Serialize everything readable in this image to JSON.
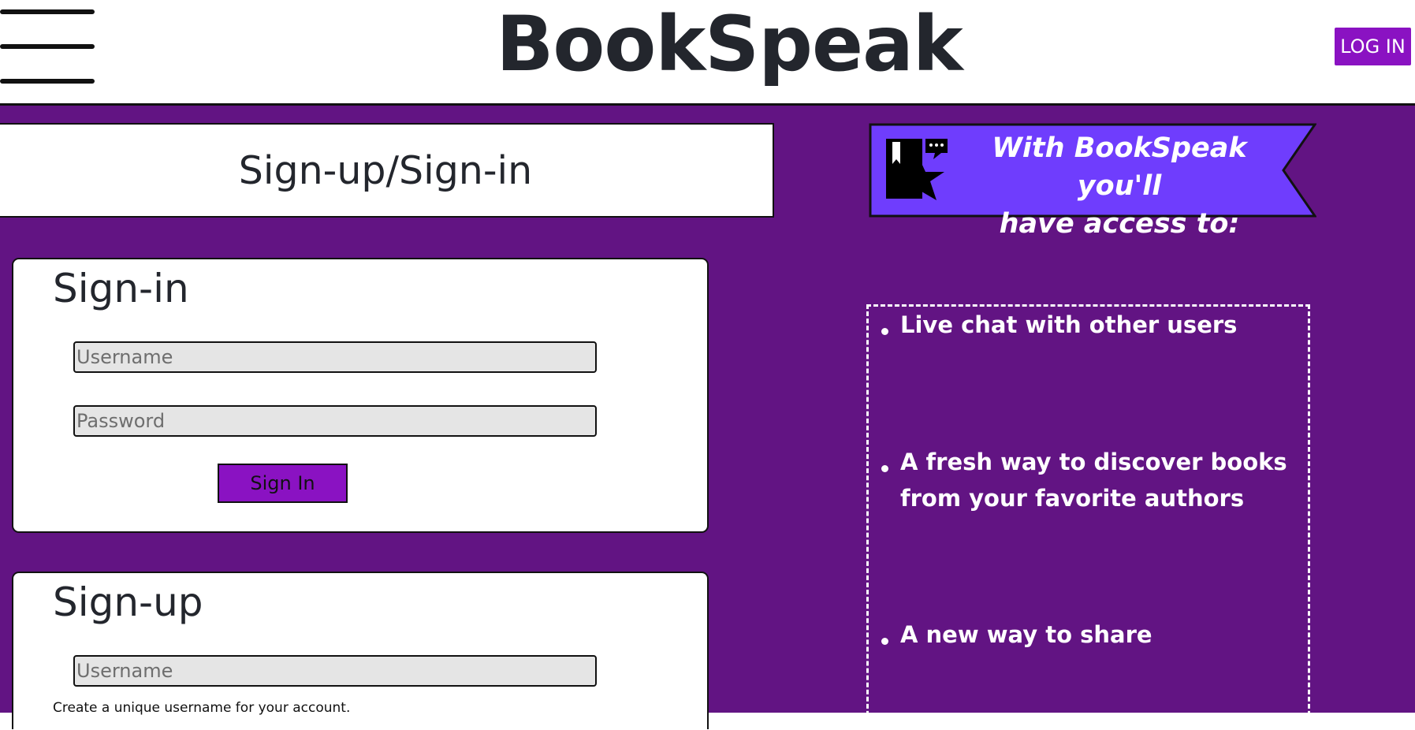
{
  "header": {
    "brand": "BookSpeak",
    "login_label": "LOG IN"
  },
  "page": {
    "title": "Sign-up/Sign-in"
  },
  "signin": {
    "heading": "Sign-in",
    "username_placeholder": "Username",
    "password_placeholder": "Password",
    "button_label": "Sign In"
  },
  "signup": {
    "heading": "Sign-up",
    "username_placeholder": "Username",
    "username_hint": "Create a unique username for your account."
  },
  "promo": {
    "banner_line1": "With BookSpeak you'll",
    "banner_line2": "have access to:",
    "features": [
      "Live chat with other users",
      "A fresh way to discover books from your favorite authors",
      "A new way to share"
    ]
  },
  "colors": {
    "brand_purple": "#621483",
    "button_purple": "#8a12c2",
    "banner_blue": "#6f3dfd"
  }
}
